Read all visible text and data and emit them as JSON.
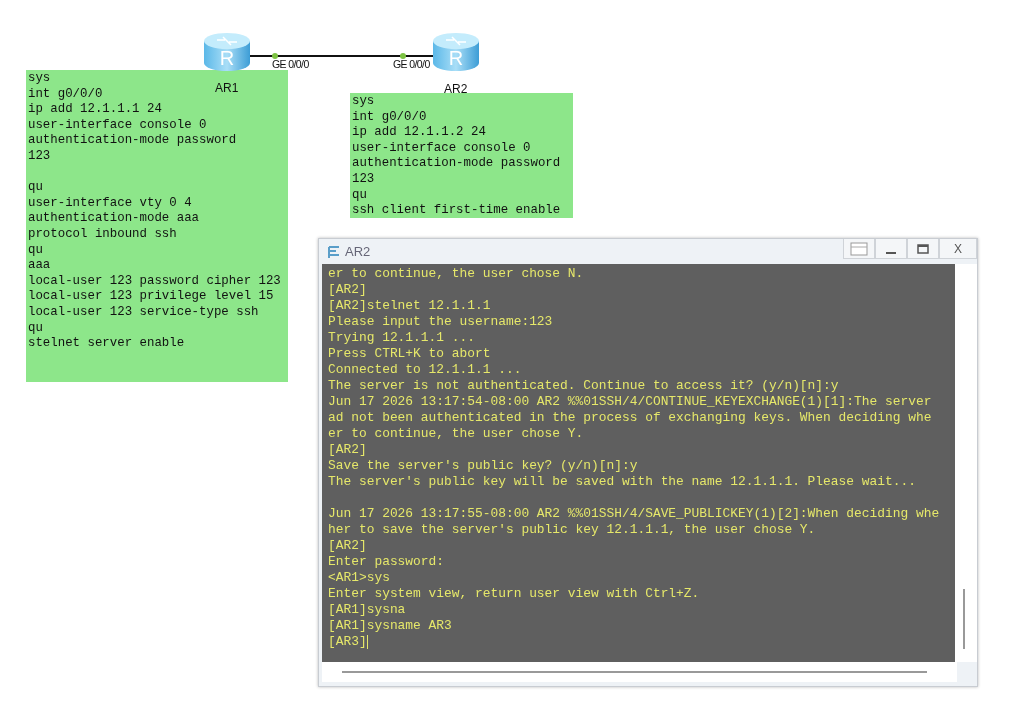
{
  "devices": [
    {
      "name": "AR1",
      "icon_letter": "R",
      "port": "GE 0/0/0"
    },
    {
      "name": "AR2",
      "icon_letter": "R",
      "port": "GE 0/0/0"
    }
  ],
  "notes": [
    {
      "blocks": [
        [
          "sys",
          "int g0/0/0",
          "ip add 12.1.1.1 24",
          "user-interface console 0",
          "authentication-mode password",
          "123"
        ],
        [
          "qu",
          "user-interface vty 0 4",
          "authentication-mode aaa",
          "protocol inbound ssh",
          "qu",
          "aaa",
          "local-user 123 password cipher 123",
          "local-user 123 privilege level 15",
          "local-user 123 service-type ssh",
          "qu",
          "stelnet server enable"
        ]
      ]
    },
    {
      "blocks": [
        [
          "sys",
          "int g0/0/0",
          "ip add 12.1.1.2 24",
          "user-interface console 0",
          "authentication-mode password",
          "123",
          "qu",
          "ssh client first-time enable"
        ]
      ]
    }
  ],
  "terminal": {
    "title": "AR2",
    "close": "X",
    "cursor": true,
    "blocks": [
      [
        "er to continue, the user chose N.",
        "[AR2]",
        "[AR2]stelnet 12.1.1.1",
        "Please input the username:123",
        "Trying 12.1.1.1 ...",
        "Press CTRL+K to abort",
        "Connected to 12.1.1.1 ...",
        "The server is not authenticated. Continue to access it? (y/n)[n]:y",
        "Jun 17 2026 13:17:54-08:00 AR2 %%01SSH/4/CONTINUE_KEYEXCHANGE(1)[1]:The server",
        "ad not been authenticated in the process of exchanging keys. When deciding whe",
        "er to continue, the user chose Y.",
        "[AR2]",
        "Save the server's public key? (y/n)[n]:y",
        "The server's public key will be saved with the name 12.1.1.1. Please wait..."
      ],
      [
        "Jun 17 2026 13:17:55-08:00 AR2 %%01SSH/4/SAVE_PUBLICKEY(1)[2]:When deciding whe",
        "her to save the server's public key 12.1.1.1, the user chose Y.",
        "[AR2]",
        "Enter password:",
        "<AR1>sys",
        "Enter system view, return user view with Ctrl+Z.",
        "[AR1]sysna",
        "[AR1]sysname AR3",
        "[AR3]"
      ]
    ]
  }
}
